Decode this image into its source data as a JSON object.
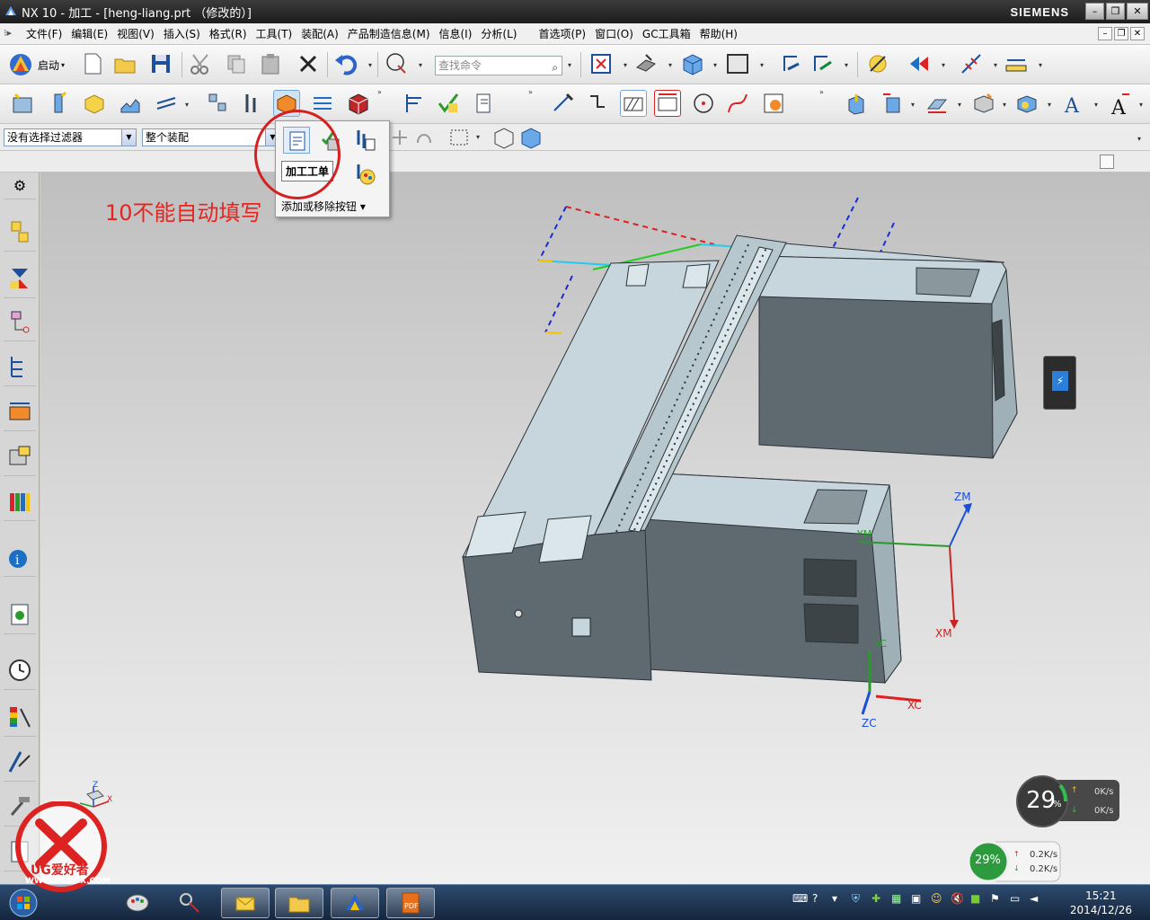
{
  "window": {
    "title": "NX 10 - 加工 - [heng-liang.prt （修改的）]",
    "brand": "SIEMENS"
  },
  "menu": {
    "items": [
      "文件(F)",
      "编辑(E)",
      "视图(V)",
      "插入(S)",
      "格式(R)",
      "工具(T)",
      "装配(A)",
      "产品制造信息(M)",
      "信息(I)",
      "分析(L)",
      "首选项(P)",
      "窗口(O)",
      "GC工具箱",
      "帮助(H)"
    ]
  },
  "toolbar": {
    "start_label": "启动",
    "search_placeholder": "查找命令"
  },
  "filters": {
    "selection_filter": "没有选择过滤器",
    "scope": "整个装配"
  },
  "popup": {
    "tooltip": "加工工单",
    "add_remove": "添加或移除按钮"
  },
  "annotation": {
    "text": "10不能自动填写"
  },
  "axes": {
    "zm": "ZM",
    "xm": "XM",
    "ym": "YM",
    "zc": "ZC",
    "xc": "XC",
    "yc": "YC"
  },
  "widgets": {
    "cpu_gauge": "29",
    "cpu_unit": "%",
    "up_speed_1": "0K/s",
    "down_speed_1": "0K/s",
    "percent_badge": "29%",
    "up_speed_2": "0.2K/s",
    "down_speed_2": "0.2K/s"
  },
  "watermark": {
    "brand": "UG爱好者",
    "url": "WWW.UGSNX.COM"
  },
  "taskbar": {
    "time": "15:21",
    "date": "2014/12/26"
  },
  "colors": {
    "model": "#5f6a70",
    "model_top": "#c7d6dc",
    "annotation": "#e8241f",
    "circle": "#d42020"
  }
}
